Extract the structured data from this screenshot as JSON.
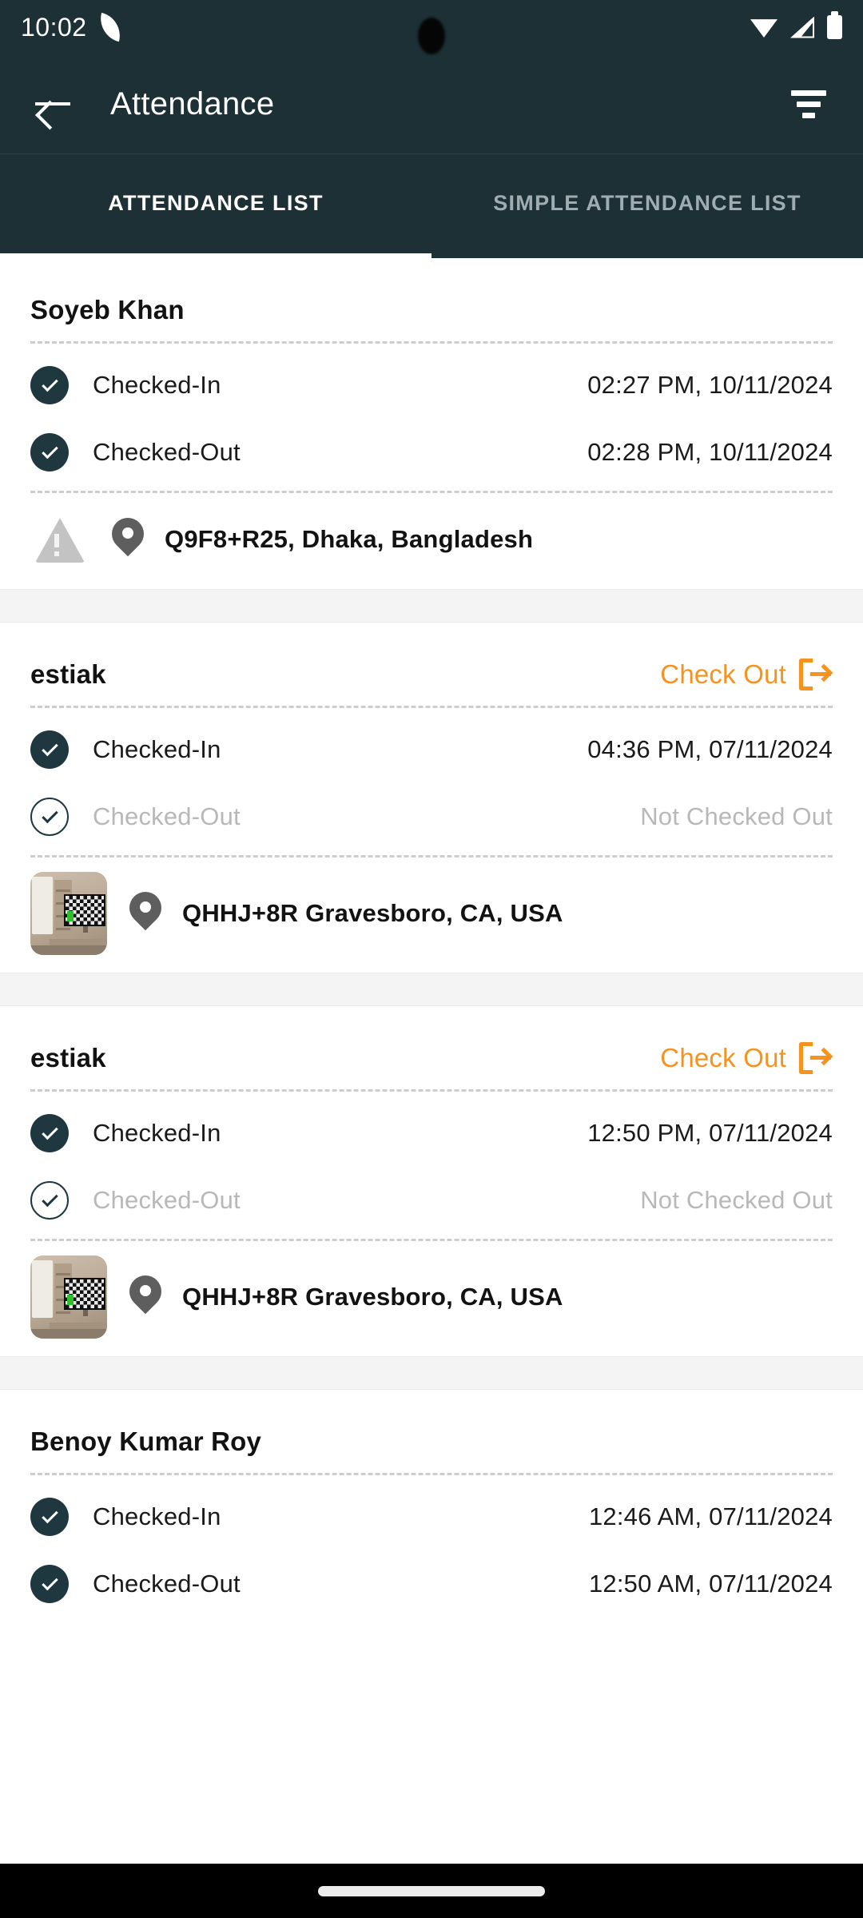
{
  "status_bar": {
    "time": "10:02",
    "icons": [
      "leaf-icon",
      "wifi-icon",
      "signal-icon",
      "battery-icon"
    ]
  },
  "app_bar": {
    "back_icon": "back-arrow-icon",
    "title": "Attendance",
    "filter_icon": "filter-icon"
  },
  "tabs": [
    {
      "label": "ATTENDANCE LIST",
      "active": true
    },
    {
      "label": "SIMPLE ATTENDANCE LIST",
      "active": false
    }
  ],
  "colors": {
    "header_bg": "#1c3036",
    "accent_orange": "#f59321",
    "check_filled": "#1f383f",
    "muted_text": "#b8b8b8",
    "separator_bg": "#f4f4f4"
  },
  "labels": {
    "checked_in": "Checked-In",
    "checked_out": "Checked-Out",
    "not_checked_out": "Not Checked Out",
    "check_out_action": "Check Out"
  },
  "cards": [
    {
      "name": "Soyeb Khan",
      "has_checkout_button": false,
      "checkin_time": "02:27 PM, 10/11/2024",
      "checkout_time": "02:28 PM, 10/11/2024",
      "checked_out": true,
      "location": "Q9F8+R25, Dhaka, Bangladesh",
      "thumb_type": "broken-image"
    },
    {
      "name": "estiak",
      "has_checkout_button": true,
      "checkin_time": "04:36 PM, 07/11/2024",
      "checkout_time": "Not Checked Out",
      "checked_out": false,
      "location": "QHHJ+8R Gravesboro, CA, USA",
      "thumb_type": "photo"
    },
    {
      "name": "estiak",
      "has_checkout_button": true,
      "checkin_time": "12:50 PM, 07/11/2024",
      "checkout_time": "Not Checked Out",
      "checked_out": false,
      "location": "QHHJ+8R Gravesboro, CA, USA",
      "thumb_type": "photo"
    },
    {
      "name": "Benoy Kumar Roy",
      "has_checkout_button": false,
      "checkin_time": "12:46 AM, 07/11/2024",
      "checkout_time": "12:50 AM, 07/11/2024",
      "checked_out": true,
      "location": "",
      "thumb_type": "none"
    }
  ]
}
